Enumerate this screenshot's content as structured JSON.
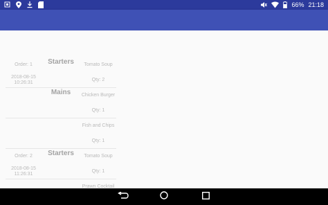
{
  "status_bar": {
    "battery_percent": "66%",
    "time": "21:18",
    "icons": [
      "notification-icon",
      "location-icon",
      "download-icon",
      "sd-card-icon",
      "muted-icon",
      "wifi-icon",
      "battery-icon"
    ]
  },
  "orders": [
    {
      "order_label": "Order: 1",
      "date": "2018-08-15",
      "time": "10:26:31",
      "categories": [
        {
          "name": "Starters",
          "items": [
            {
              "name": "Tomato Soup",
              "qty": "Qty: 2"
            }
          ]
        },
        {
          "name": "Mains",
          "items": [
            {
              "name": "Chicken Burger",
              "qty": "Qty: 1"
            },
            {
              "name": "Fish and Chips",
              "qty": "Qty: 1"
            }
          ]
        }
      ]
    },
    {
      "order_label": "Order: 2",
      "date": "2018-08-15",
      "time": "11:26:31",
      "categories": [
        {
          "name": "Starters",
          "items": [
            {
              "name": "Tomato Soup",
              "qty": "Qty: 1"
            },
            {
              "name": "Prawn Cocktail",
              "qty": ""
            }
          ]
        }
      ]
    }
  ],
  "nav_bar": {
    "buttons": [
      "back-icon",
      "home-icon",
      "recents-icon"
    ]
  }
}
